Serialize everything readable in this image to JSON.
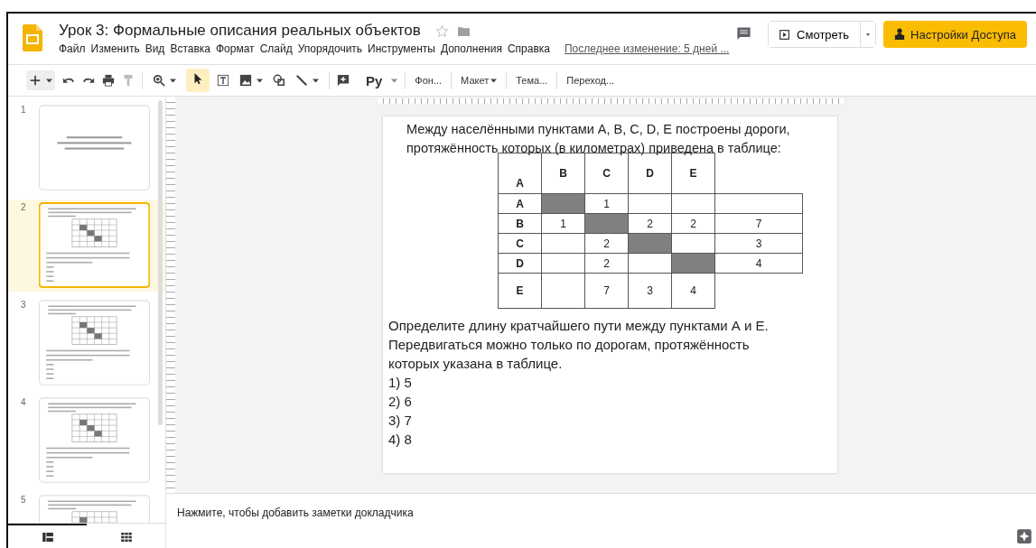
{
  "header": {
    "title": "Урок 3: Формальные описания реальных объектов",
    "starred": false,
    "menu": [
      "Файл",
      "Изменить",
      "Вид",
      "Вставка",
      "Формат",
      "Слайд",
      "Упорядочить",
      "Инструменты",
      "Дополнения",
      "Справка"
    ],
    "last_edit": "Последнее изменение: 5 дней ...",
    "present_button": "Смотреть",
    "share_button": "Настройки Доступа"
  },
  "toolbar": {
    "pointer_selected": true,
    "input_tool": "Ру",
    "buttons": [
      {
        "label": "Фон...",
        "dropdown": false
      },
      {
        "label": "Макет",
        "dropdown": true
      },
      {
        "label": "Тема...",
        "dropdown": false
      },
      {
        "label": "Переход...",
        "dropdown": false
      }
    ]
  },
  "slides": [
    {
      "number": "1",
      "selected": false,
      "kind": "title"
    },
    {
      "number": "2",
      "selected": true,
      "kind": "table"
    },
    {
      "number": "3",
      "selected": false,
      "kind": "table"
    },
    {
      "number": "4",
      "selected": false,
      "kind": "table"
    },
    {
      "number": "5",
      "selected": false,
      "kind": "table"
    }
  ],
  "views": [
    {
      "selected": true
    },
    {
      "selected": false
    }
  ],
  "slide": {
    "intro": "Между населёнными пунктами A, B, C, D, E построены дороги, протяжённость которых (в километрах) приведена в таблице:",
    "table": {
      "header": [
        "A",
        "B",
        "C",
        "D",
        "E"
      ],
      "rows": [
        {
          "label": "A",
          "cells": [
            {
              "shaded": true,
              "text": ""
            },
            {
              "shaded": false,
              "text": "1"
            },
            {
              "shaded": false,
              "text": ""
            },
            {
              "shaded": false,
              "text": ""
            },
            {
              "shaded": false,
              "text": ""
            }
          ]
        },
        {
          "label": "B",
          "cells": [
            {
              "shaded": false,
              "text": "1"
            },
            {
              "shaded": true,
              "text": ""
            },
            {
              "shaded": false,
              "text": "2"
            },
            {
              "shaded": false,
              "text": "2"
            },
            {
              "shaded": false,
              "text": "7"
            }
          ]
        },
        {
          "label": "C",
          "cells": [
            {
              "shaded": false,
              "text": ""
            },
            {
              "shaded": false,
              "text": "2"
            },
            {
              "shaded": true,
              "text": ""
            },
            {
              "shaded": false,
              "text": ""
            },
            {
              "shaded": false,
              "text": "3"
            }
          ]
        },
        {
          "label": "D",
          "cells": [
            {
              "shaded": false,
              "text": ""
            },
            {
              "shaded": false,
              "text": "2"
            },
            {
              "shaded": false,
              "text": ""
            },
            {
              "shaded": true,
              "text": ""
            },
            {
              "shaded": false,
              "text": "4"
            }
          ]
        },
        {
          "label": "E",
          "cells": [
            {
              "shaded": false,
              "text": ""
            },
            {
              "shaded": false,
              "text": "7"
            },
            {
              "shaded": false,
              "text": "3"
            },
            {
              "shaded": false,
              "text": "4"
            }
          ]
        }
      ]
    },
    "question": [
      "Определите длину кратчайшего пути между пунктами А и Е.",
      "Передвигаться можно только по дорогам, протяжённость",
      "которых указана в таблице."
    ],
    "answers": [
      "1) 5",
      "2) 6",
      "3) 7",
      "4) 8"
    ]
  },
  "notes": {
    "placeholder": "Нажмите, чтобы добавить заметки докладчика"
  }
}
